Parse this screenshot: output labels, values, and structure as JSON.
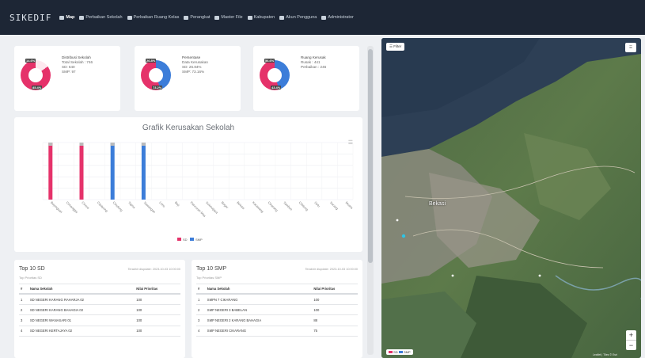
{
  "app": {
    "brand": "SIKEDIF"
  },
  "nav": [
    {
      "label": "Map",
      "icon": "map-icon"
    },
    {
      "label": "Perbaikan Sekolah",
      "icon": "tools-icon"
    },
    {
      "label": "Perbaikan Ruang Kelas",
      "icon": "tools-icon"
    },
    {
      "label": "Perangkat",
      "icon": "device-icon"
    },
    {
      "label": "Master File",
      "icon": "file-icon"
    },
    {
      "label": "Kabupaten",
      "icon": "building-icon"
    },
    {
      "label": "Akun Pengguna",
      "icon": "users-icon"
    },
    {
      "label": "Administrator",
      "icon": "user-icon"
    }
  ],
  "stats": [
    {
      "title": "Distribusi Sekolah",
      "lines": [
        "Total Sekolah : 746",
        "SD: 640",
        "SMP: 97"
      ],
      "pct_a": "14.6%",
      "pct_b": "85.4%",
      "colors": [
        "#e5326a",
        "#ffffff"
      ]
    },
    {
      "title": "Persentase",
      "lines": [
        "Data Kerusakan",
        "SD: 26.84%",
        "SMP: 73.16%"
      ],
      "pct_a": "26.8%",
      "pct_b": "73.2%",
      "colors": [
        "#e5326a",
        "#3c7dd9"
      ]
    },
    {
      "title": "Ruang Kerusak",
      "lines": [
        "Rusak : 441",
        "Perbaikan : 246"
      ],
      "pct_a": "56.6%",
      "pct_b": "43.4%",
      "colors": [
        "#e5326a",
        "#3c7dd9"
      ]
    }
  ],
  "chart": {
    "title": "Grafik Kerusakan Sekolah",
    "legend": [
      "SD",
      "SMP"
    ]
  },
  "chart_data": {
    "type": "bar",
    "title": "Grafik Kerusakan Sekolah",
    "series": [
      {
        "name": "SD",
        "color": "#e5326a",
        "values": [
          100,
          0,
          100,
          0,
          0,
          0,
          0,
          0,
          0,
          0,
          0,
          0,
          0,
          0,
          0,
          0,
          0,
          0,
          0,
          0
        ]
      },
      {
        "name": "SMP",
        "color": "#3c7dd9",
        "values": [
          0,
          0,
          0,
          0,
          100,
          0,
          100,
          0,
          0,
          0,
          0,
          0,
          0,
          0,
          0,
          0,
          0,
          0,
          0,
          0
        ]
      }
    ],
    "categories": [
      "Bojongsari",
      "Cimanggis",
      "Cinere",
      "Cipayung",
      "Cilodong",
      "Tapos",
      "Sawangan",
      "Limo",
      "Beji",
      "Pancoran Mas",
      "Sukmajaya",
      "Bogor",
      "Bekasi",
      "Karawang",
      "Cikarang",
      "Tambun",
      "Cibitung",
      "Setu",
      "Serang",
      "Muara"
    ],
    "ylim": [
      0,
      100
    ],
    "legend": "bottom"
  },
  "tables": [
    {
      "title": "Top 10 SD",
      "updated": "Terakhir diupdate: 2023-10-03 10:00:00",
      "subtitle": "Top Prioritas SD",
      "headers": [
        "#",
        "Nama Sekolah",
        "Nilai Prioritas"
      ],
      "rows": [
        [
          "1",
          "SD NEGERI KARANG RAHARJA 02",
          "100"
        ],
        [
          "2",
          "SD NEGERI KARANG BAHAGIA 02",
          "100"
        ],
        [
          "3",
          "SD NEGERI WANASARI 01",
          "100"
        ],
        [
          "4",
          "SD NEGERI KERTAJAYA 02",
          "100"
        ]
      ]
    },
    {
      "title": "Top 10 SMP",
      "updated": "Terakhir diupdate: 2023-10-03 10:00:00",
      "subtitle": "Top Prioritas SMP",
      "headers": [
        "#",
        "Nama Sekolah",
        "Nilai Prioritas"
      ],
      "rows": [
        [
          "1",
          "SMPN 7 CIKARANG",
          "100"
        ],
        [
          "2",
          "SMP NEGERI 3 BABELAN",
          "100"
        ],
        [
          "3",
          "SMP NEGERI 2 KARANG BAHAGIA",
          "88"
        ],
        [
          "4",
          "SMP NEGERI CIKARANG",
          "75"
        ]
      ]
    }
  ],
  "map": {
    "filter_label": "Filter",
    "cities": [
      "Bekasi"
    ],
    "legend": [
      "SD",
      "SMP"
    ],
    "attribution": "Leaflet | Tiles © Esri"
  }
}
